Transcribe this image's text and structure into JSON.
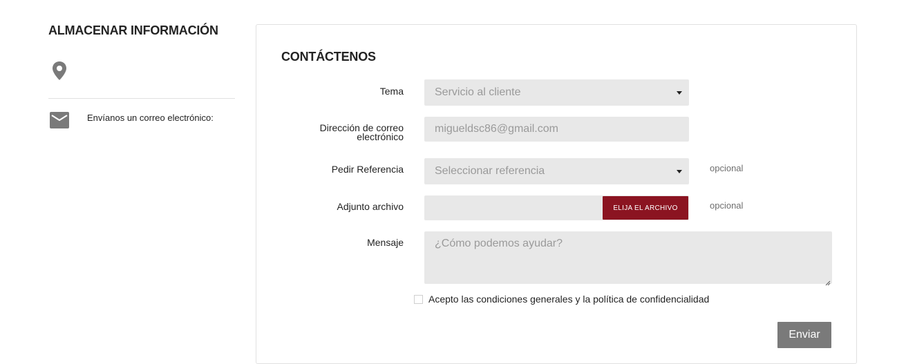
{
  "store": {
    "title": "ALMACENAR INFORMACIÓN",
    "email_label": "Envíanos un correo electrónico:",
    "icons": {
      "location": "location-pin-icon",
      "email": "envelope-icon"
    }
  },
  "contact": {
    "title": "CONTÁCTENOS",
    "subject": {
      "label": "Tema",
      "value": "Servicio al cliente"
    },
    "email": {
      "label_line1": "Dirección de correo",
      "label_line2": "electrónico",
      "value": "migueldsc86@gmail.com"
    },
    "order_reference": {
      "label": "Pedir Referencia",
      "value": "Seleccionar referencia",
      "optional": "opcional"
    },
    "attachment": {
      "label": "Adjunto archivo",
      "button": "ELIJA EL ARCHIVO",
      "optional": "opcional"
    },
    "message": {
      "label": "Mensaje",
      "placeholder": "¿Cómo podemos ayudar?"
    },
    "consent": {
      "label": "Acepto las condiciones generales y la política de confidencialidad",
      "checked": false
    },
    "submit": "Enviar"
  },
  "colors": {
    "accent": "#8b1421",
    "field_bg": "#e8e8e8",
    "submit_bg": "#7a7a7a"
  }
}
